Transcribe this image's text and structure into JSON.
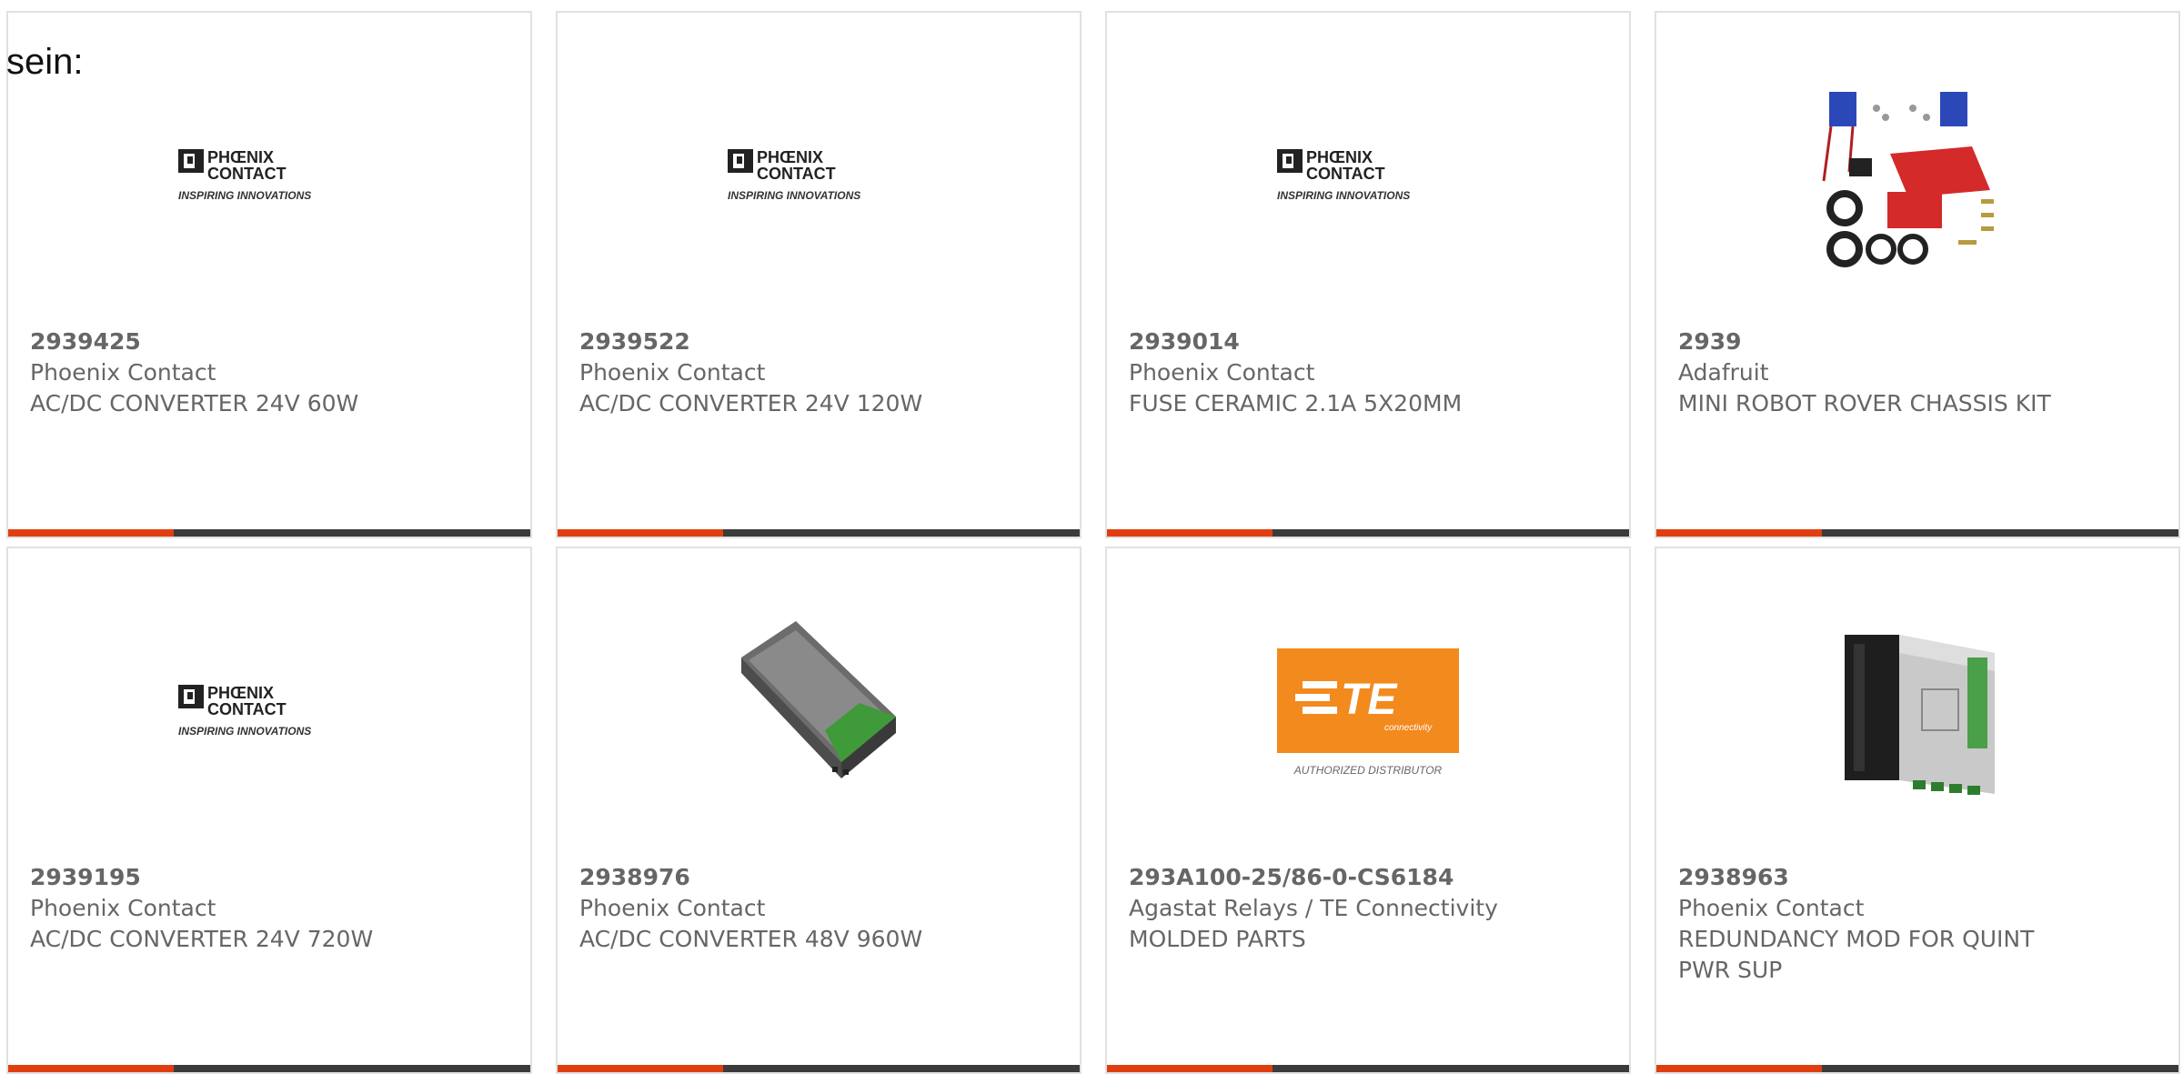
{
  "intro_text": "sein:",
  "colors": {
    "accent_red": "#e03e10",
    "accent_dark": "#3b3b3b",
    "text_gray": "#666666",
    "te_orange": "#f28a1e"
  },
  "products": [
    {
      "part": "2939425",
      "manufacturer": "Phoenix Contact",
      "description": "AC/DC CONVERTER 24V 60W",
      "image": "phoenix-contact-logo",
      "logo_line1": "PHŒNIX",
      "logo_line2": "CONTACT",
      "logo_tagline": "INSPIRING INNOVATIONS"
    },
    {
      "part": "2939522",
      "manufacturer": "Phoenix Contact",
      "description": "AC/DC CONVERTER 24V 120W",
      "image": "phoenix-contact-logo",
      "logo_line1": "PHŒNIX",
      "logo_line2": "CONTACT",
      "logo_tagline": "INSPIRING INNOVATIONS"
    },
    {
      "part": "2939014",
      "manufacturer": "Phoenix Contact",
      "description": "FUSE CERAMIC 2.1A 5X20MM",
      "image": "phoenix-contact-logo",
      "logo_line1": "PHŒNIX",
      "logo_line2": "CONTACT",
      "logo_tagline": "INSPIRING INNOVATIONS"
    },
    {
      "part": "2939",
      "manufacturer": "Adafruit",
      "description": "MINI ROBOT ROVER CHASSIS KIT",
      "image": "robot-kit-photo"
    },
    {
      "part": "2939195",
      "manufacturer": "Phoenix Contact",
      "description": "AC/DC CONVERTER 24V 720W",
      "image": "phoenix-contact-logo",
      "logo_line1": "PHŒNIX",
      "logo_line2": "CONTACT",
      "logo_tagline": "INSPIRING INNOVATIONS"
    },
    {
      "part": "2938976",
      "manufacturer": "Phoenix Contact",
      "description": "AC/DC CONVERTER 48V 960W",
      "image": "converter-module-photo"
    },
    {
      "part": "293A100-25/86-0-CS6184",
      "manufacturer": "Agastat Relays / TE Connectivity",
      "description": "MOLDED PARTS",
      "image": "te-connectivity-logo",
      "logo_main": "TE",
      "logo_sub": "connectivity",
      "logo_caption": "AUTHORIZED DISTRIBUTOR"
    },
    {
      "part": "2938963",
      "manufacturer": "Phoenix Contact",
      "description": "REDUNDANCY MOD FOR QUINT PWR SUP",
      "image": "redundancy-module-photo"
    }
  ]
}
